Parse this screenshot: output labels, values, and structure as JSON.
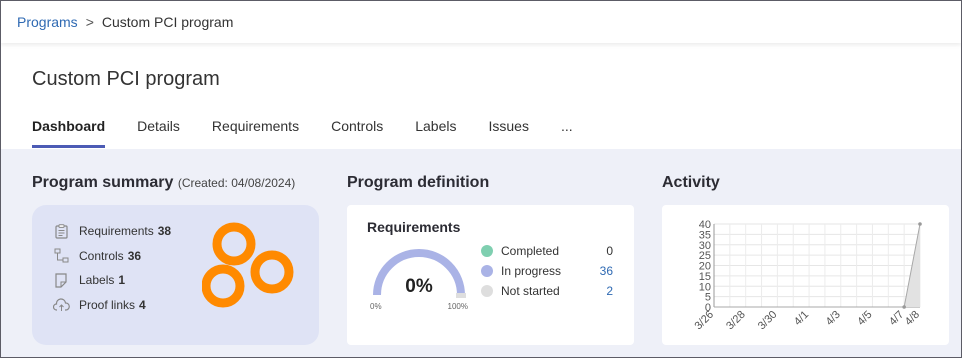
{
  "breadcrumb": {
    "parent": "Programs",
    "separator": ">",
    "current": "Custom PCI program"
  },
  "page": {
    "title": "Custom PCI program"
  },
  "tabs": [
    {
      "label": "Dashboard",
      "active": true
    },
    {
      "label": "Details"
    },
    {
      "label": "Requirements"
    },
    {
      "label": "Controls"
    },
    {
      "label": "Labels"
    },
    {
      "label": "Issues"
    },
    {
      "label": "..."
    }
  ],
  "summary": {
    "title": "Program summary",
    "created": "(Created: 04/08/2024)",
    "items": [
      {
        "label": "Requirements",
        "count": "38",
        "icon": "clipboard-icon"
      },
      {
        "label": "Controls",
        "count": "36",
        "icon": "hierarchy-icon"
      },
      {
        "label": "Labels",
        "count": "1",
        "icon": "label-icon"
      },
      {
        "label": "Proof links",
        "count": "4",
        "icon": "cloud-upload-icon"
      }
    ],
    "ring_color": "#ff8a00"
  },
  "definition": {
    "title": "Program definition",
    "card_title": "Requirements",
    "percent": "0%",
    "percent_value": 0,
    "min_label": "0%",
    "max_label": "100%",
    "legend": [
      {
        "label": "Completed",
        "value": "0",
        "color": "#7fcfb0",
        "link": false
      },
      {
        "label": "In progress",
        "value": "36",
        "color": "#aab3e6",
        "link": true
      },
      {
        "label": "Not started",
        "value": "2",
        "color": "#dedede",
        "link": true
      }
    ]
  },
  "activity": {
    "title": "Activity"
  },
  "chart_data": {
    "type": "area",
    "title": "",
    "xlabel": "",
    "ylabel": "",
    "x": [
      "3/26",
      "3/27",
      "3/28",
      "3/29",
      "3/30",
      "3/31",
      "4/1",
      "4/2",
      "4/3",
      "4/4",
      "4/5",
      "4/6",
      "4/7",
      "4/8"
    ],
    "x_tick_labels": [
      "3/26",
      "3/28",
      "3/30",
      "4/1",
      "4/3",
      "4/5",
      "4/7",
      "4/8"
    ],
    "series": [
      {
        "values": [
          0,
          0,
          0,
          0,
          0,
          0,
          0,
          0,
          0,
          0,
          0,
          0,
          0,
          40
        ]
      }
    ],
    "ylim": [
      0,
      40
    ],
    "y_ticks": [
      0,
      5,
      10,
      15,
      20,
      25,
      30,
      35,
      40
    ],
    "grid": true
  }
}
